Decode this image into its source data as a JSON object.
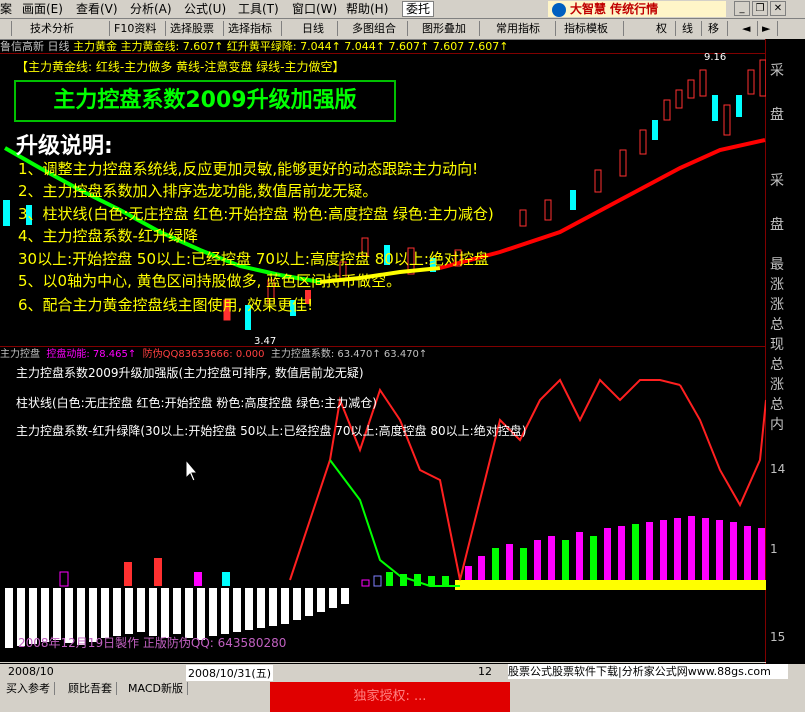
{
  "menu": [
    "案",
    "画面(E)",
    "查看(V)",
    "分析(A)",
    "公式(U)",
    "工具(T)",
    "窗口(W)",
    "帮助(H)",
    "委托"
  ],
  "toolbar": [
    "技术分析",
    "F10资料",
    "选择股票",
    "选择指标",
    "日线",
    "多图组合",
    "图形叠加",
    "常用指标",
    "指标模板",
    "权",
    "线",
    "移"
  ],
  "logo_text": "大智慧 传统行情",
  "stock_line": {
    "name": "鲁信高新 日线",
    "items": "主力黄金  主力黄金线: 7.607↑  红升黄平绿降: 7.044↑  7.044↑  7.607↑  7.607  7.607↑"
  },
  "legend_line": "【主力黄金线: 红线-主力做多   黄线-注意变盘   绿线-主力做空】",
  "headline": "主力控盘系数2009升级加强版",
  "upgrade_title": "升级说明:",
  "notes": [
    "1、调整主力控盘系统线,反应更加灵敏,能够更好的动态跟踪主力动向!",
    "2、主力控盘系数加入排序选龙功能,数值居前龙无疑。",
    "3、柱状线(白色:无庄控盘 红色:开始控盘 粉色:高度控盘 绿色:主力减仓)",
    "4、主力控盘系数-红升绿降",
    "  30以上:开始控盘 50以上:已经控盘 70以上:高度控盘 80以上:绝对控盘",
    "5、以0轴为中心, 黄色区间持股做多, 蓝色区间持币做空。",
    "6、配合主力黄金控盘线主图使用, 效果更佳!"
  ],
  "price_marks": {
    "high": "9.16",
    "low": "3.47"
  },
  "indicator_line": {
    "label": "主力控盘",
    "kinetic": "控盘动能: 78.465↑",
    "anti": "防伪QQ83653666: 0.000",
    "coef": "主力控盘系数: 63.470↑  63.470↑"
  },
  "sub_notes": [
    "主力控盘系数2009升级加强版(主力控盘可排序, 数值居前龙无疑)",
    "柱状线(白色:无庄控盘 红色:开始控盘 粉色:高度控盘 绿色:主力减仓)",
    "主力控盘系数-红升绿降(30以上:开始控盘 50以上:已经控盘 70以上:高度控盘 80以上:绝对控盘)"
  ],
  "watermark": "2008年12月19日製作 正版防伪QQ: 643580280",
  "right_labels": {
    "top1": "采",
    "top2": "盘",
    "mid1": "采",
    "mid2": "盘",
    "side": [
      "最",
      "涨",
      "涨",
      "总",
      "现",
      "总",
      "涨",
      "总",
      "内"
    ],
    "n14": "14",
    "n1": "1",
    "n15": "15"
  },
  "dates": [
    "2008/10",
    "2008/10/31(五)",
    "12"
  ],
  "bottom_banner": "股票公式股票软件下载|分析家公式网www.88gs.com",
  "bottom_tabs": [
    "买入参考",
    "顾比吾套",
    "MACD新版"
  ],
  "bottom_red": "独家授权: ..."
}
